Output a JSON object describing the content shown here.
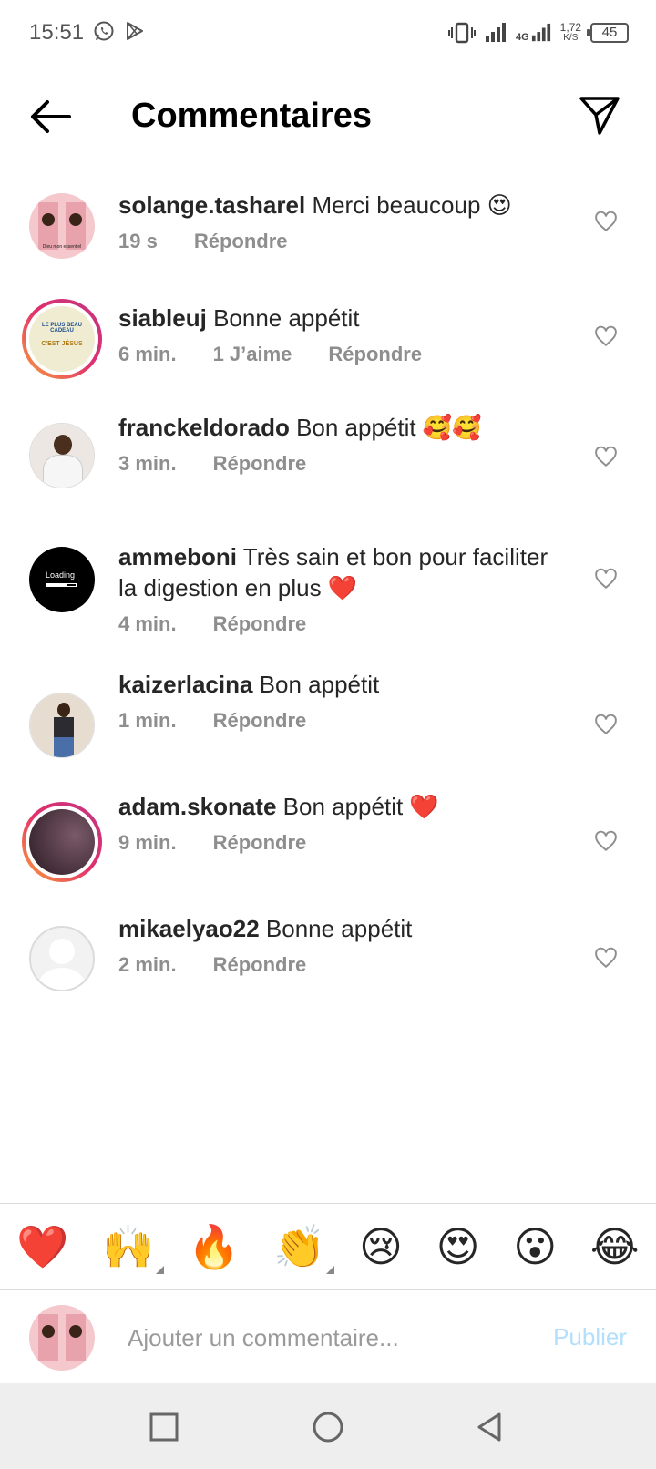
{
  "status_bar": {
    "time": "15:51",
    "network": "4G",
    "speed_value": "1,72",
    "speed_unit": "K/S",
    "battery": "45",
    "icons": [
      "whatsapp-icon",
      "play-store-icon",
      "vibrate-icon",
      "signal-icon",
      "signal-4g-icon",
      "battery-icon"
    ]
  },
  "header": {
    "title": "Commentaires",
    "icons": [
      "back-arrow-icon",
      "send-icon"
    ]
  },
  "comments": [
    {
      "username": "solange.tasharel",
      "text": "Merci beaucoup 😍",
      "time": "19 s",
      "likes": "",
      "reply": "Répondre"
    },
    {
      "username": "siableuj",
      "text": "Bonne appétit",
      "time": "6 min.",
      "likes": "1 J’aime",
      "reply": "Répondre"
    },
    {
      "username": "franckeldorado",
      "text": "Bon appétit 🥰🥰",
      "time": "3 min.",
      "likes": "",
      "reply": "Répondre"
    },
    {
      "username": "ammeboni",
      "text": "Très sain et bon pour faciliter la digestion en plus ❤️",
      "time": "4 min.",
      "likes": "",
      "reply": "Répondre"
    },
    {
      "username": "kaizerlacina",
      "text": "Bon appétit",
      "time": "1 min.",
      "likes": "",
      "reply": "Répondre"
    },
    {
      "username": "adam.skonate",
      "text": "Bon appétit ❤️",
      "time": "9 min.",
      "likes": "",
      "reply": "Répondre"
    },
    {
      "username": "mikaelyao22",
      "text": "Bonne appétit",
      "time": "2 min.",
      "likes": "",
      "reply": "Répondre"
    }
  ],
  "avatar_texts": {
    "siableuj_line1": "LE PLUS BEAU CADEAU",
    "siableuj_line2": "C'EST JÉSUS",
    "ammeboni_loading": "Loading",
    "solange_caption": "Dieu mon essentiel"
  },
  "emoji_bar": [
    "❤️",
    "🙌",
    "🔥",
    "👏",
    "😢",
    "😍",
    "😮",
    "😂"
  ],
  "input": {
    "placeholder": "Ajouter un commentaire...",
    "publish_label": "Publier"
  },
  "colors": {
    "accent_disabled": "#b2dffc",
    "secondary_text": "#8e8e8e",
    "story_ring_start": "#f9a43a",
    "story_ring_end": "#c13584"
  }
}
